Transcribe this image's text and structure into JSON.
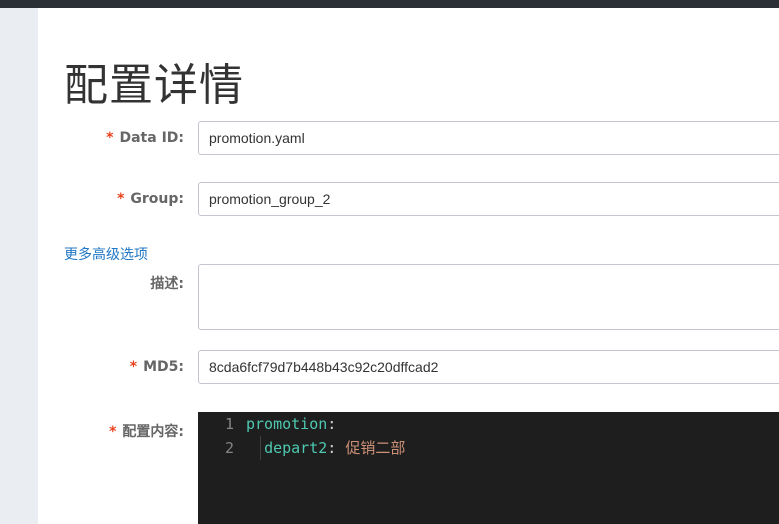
{
  "page": {
    "title": "配置详情"
  },
  "form": {
    "data_id": {
      "required_mark": "*",
      "label": "Data ID:",
      "value": "promotion.yaml"
    },
    "group": {
      "required_mark": "*",
      "label": "Group:",
      "value": "promotion_group_2"
    },
    "advanced_link": "更多高级选项",
    "description": {
      "label": "描述:",
      "value": ""
    },
    "md5": {
      "required_mark": "*",
      "label": "MD5:",
      "value": "8cda6fcf79d7b448b43c92c20dffcad2"
    },
    "content": {
      "required_mark": "*",
      "label": "配置内容:",
      "lines": [
        {
          "number": "1",
          "key": "promotion",
          "colon": ":",
          "value": ""
        },
        {
          "number": "2",
          "key": "depart2",
          "colon": ":",
          "value": "促销二部"
        }
      ]
    }
  },
  "colors": {
    "required": "#e8421c",
    "link": "#2077c4",
    "editor_bg": "#1e1e1e",
    "yaml_key": "#4ec9b0",
    "yaml_string": "#ce9178"
  }
}
